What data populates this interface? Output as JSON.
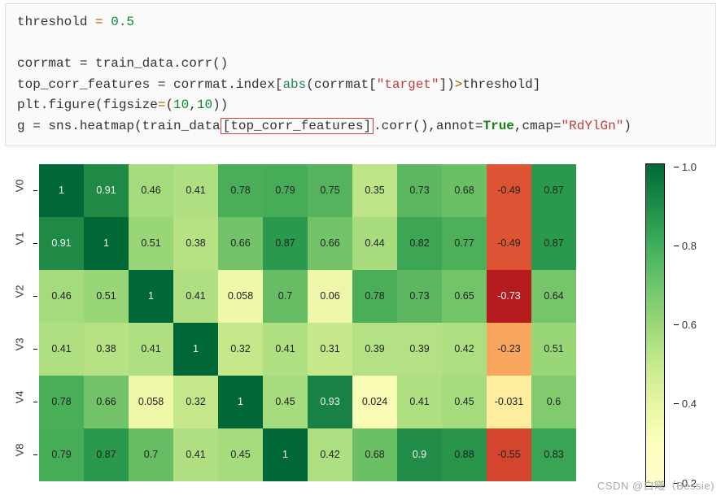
{
  "code": {
    "l1_var": "threshold ",
    "l1_op": "=",
    "l1_num": " 0.5",
    "l3": "corrmat = train_data.corr()",
    "l4_a": "top_corr_features = corrmat.index[",
    "l4_abs": "abs",
    "l4_b": "(corrmat[",
    "l4_str": "\"target\"",
    "l4_c": "])",
    "l4_gt": ">",
    "l4_d": "threshold]",
    "l5_a": "plt.figure(figsize",
    "l5_op": "=",
    "l5_b": "(",
    "l5_n1": "10",
    "l5_c": ",",
    "l5_n2": "10",
    "l5_d": "))",
    "l6_a": "g = sns.heatmap(train_data",
    "l6_box": "[top_corr_features]",
    "l6_b": ".corr(),annot=",
    "l6_true": "True",
    "l6_c": ",cmap=",
    "l6_str": "\"RdYlGn\"",
    "l6_d": ")"
  },
  "chart_data": {
    "type": "heatmap",
    "row_labels": [
      "V0",
      "V1",
      "V2",
      "V3",
      "V4",
      "V8"
    ],
    "col_count": 12,
    "values": [
      [
        1,
        0.91,
        0.46,
        0.41,
        0.78,
        0.79,
        0.75,
        0.35,
        0.73,
        0.68,
        -0.49,
        0.87
      ],
      [
        0.91,
        1,
        0.51,
        0.38,
        0.66,
        0.87,
        0.66,
        0.44,
        0.82,
        0.77,
        -0.49,
        0.87
      ],
      [
        0.46,
        0.51,
        1,
        0.41,
        0.058,
        0.7,
        0.06,
        0.78,
        0.73,
        0.65,
        -0.73,
        0.64
      ],
      [
        0.41,
        0.38,
        0.41,
        1,
        0.32,
        0.41,
        0.31,
        0.39,
        0.39,
        0.42,
        -0.23,
        0.51
      ],
      [
        0.78,
        0.66,
        0.058,
        0.32,
        1,
        0.45,
        0.93,
        0.024,
        0.41,
        0.45,
        -0.031,
        0.6
      ],
      [
        0.79,
        0.87,
        0.7,
        0.41,
        0.45,
        1,
        0.42,
        0.68,
        0.9,
        0.88,
        -0.55,
        0.83
      ]
    ],
    "colorbar": {
      "min": 0.2,
      "max": 1.0,
      "ticks": [
        1.0,
        0.8,
        0.6,
        0.4,
        0.2
      ]
    },
    "cmap": "RdYlGn"
  },
  "watermark": "CSDN @白曦（Bessie)"
}
